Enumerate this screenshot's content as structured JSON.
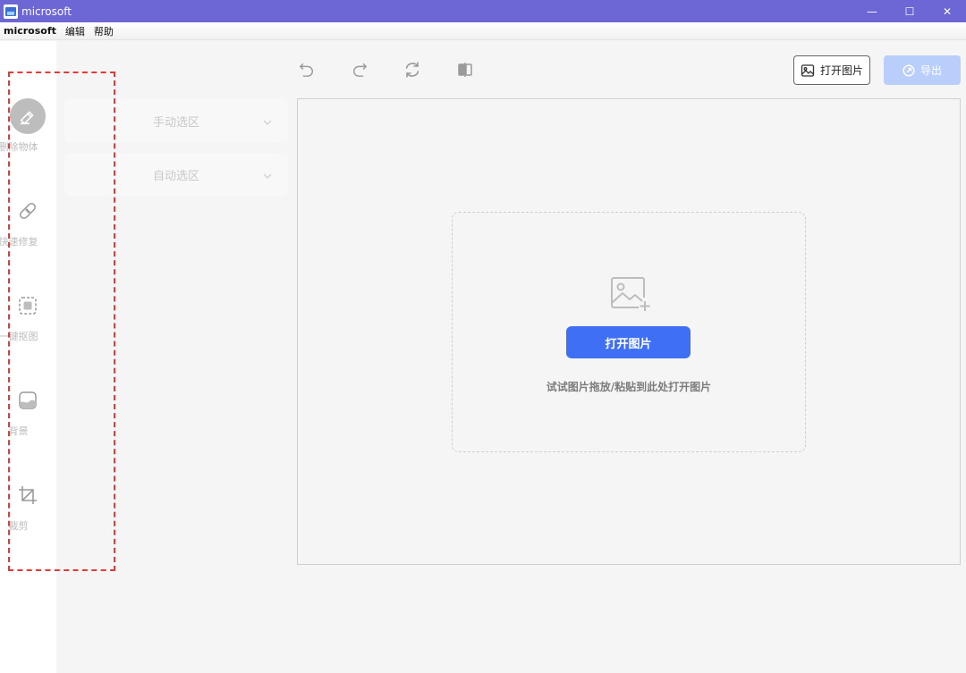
{
  "window": {
    "title": "microsoft",
    "controls": {
      "minimize": "—",
      "maximize": "☐",
      "close": "✕"
    }
  },
  "menu": {
    "items": [
      "microsoft",
      "编辑",
      "帮助"
    ]
  },
  "sidebar": {
    "tools": [
      {
        "label": "删除物体",
        "icon": "eraser-icon",
        "active": true
      },
      {
        "label": "快速修复",
        "icon": "bandage-icon",
        "active": false
      },
      {
        "label": "一键抠图",
        "icon": "cutout-icon",
        "active": false
      },
      {
        "label": "背景",
        "icon": "background-icon",
        "active": false
      },
      {
        "label": "裁剪",
        "icon": "crop-icon",
        "active": false
      }
    ],
    "highlight_color": "#e53935"
  },
  "options": {
    "manual": "手动选区",
    "auto": "自动选区"
  },
  "toolbar": {
    "undo_icon": "undo-icon",
    "redo_icon": "redo-icon",
    "reset_icon": "refresh-icon",
    "compare_icon": "compare-icon",
    "open_label": "打开图片",
    "export_label": "导出"
  },
  "dropzone": {
    "icon": "image-add-icon",
    "button_label": "打开图片",
    "hint": "试试图片拖放/粘贴到此处打开图片"
  },
  "colors": {
    "titlebar": "#6c67d4",
    "primary": "#3f6ff5",
    "export_disabled": "#b9cefb"
  }
}
